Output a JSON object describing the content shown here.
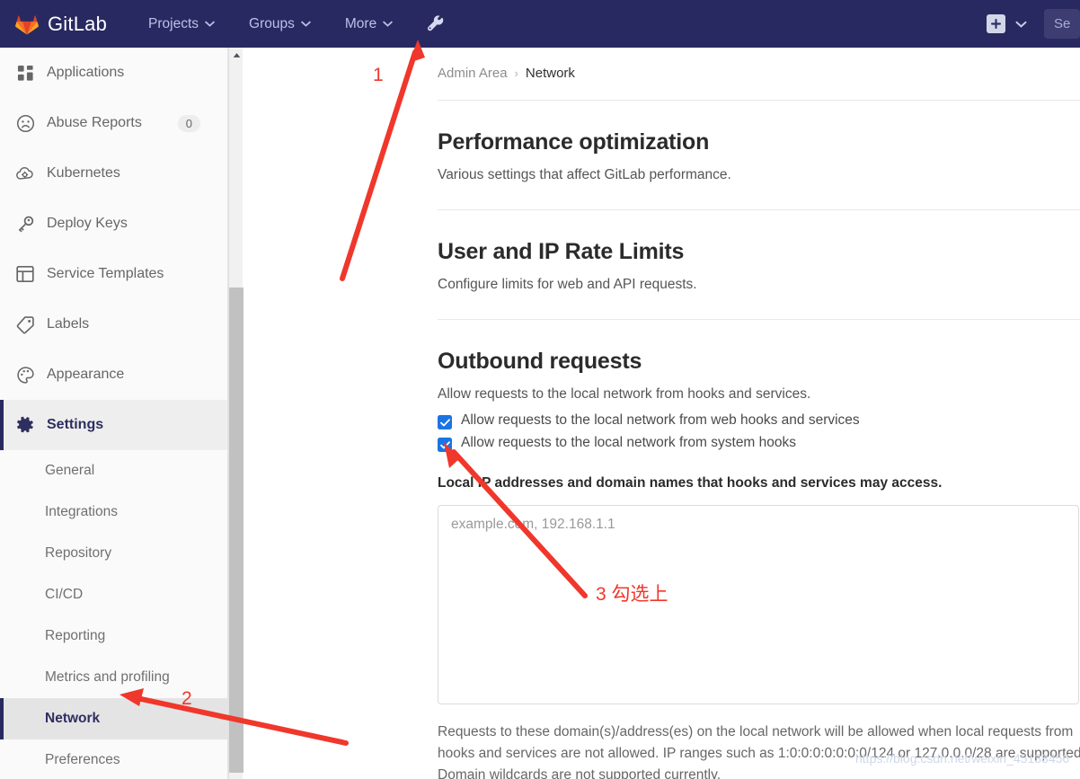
{
  "navbar": {
    "brand": "GitLab",
    "brand_logo_icon": "gitlab-tanuki-logo",
    "items": [
      {
        "label": "Projects",
        "icon": "chevron-down-icon"
      },
      {
        "label": "Groups",
        "icon": "chevron-down-icon"
      },
      {
        "label": "More",
        "icon": "chevron-down-icon"
      }
    ],
    "admin_icon": "wrench-icon",
    "new_icon": "plus-icon",
    "new_chevron_icon": "chevron-down-icon",
    "search_value": "Se",
    "search_placeholder": "Search"
  },
  "sidebar": {
    "items": [
      {
        "label": "Applications",
        "icon": "grid-applications-icon",
        "badge": "",
        "active": false
      },
      {
        "label": "Abuse Reports",
        "icon": "frown-face-icon",
        "badge": "0",
        "active": false
      },
      {
        "label": "Kubernetes",
        "icon": "cloud-gear-icon",
        "badge": "",
        "active": false
      },
      {
        "label": "Deploy Keys",
        "icon": "key-icon",
        "badge": "",
        "active": false
      },
      {
        "label": "Service Templates",
        "icon": "layout-template-icon",
        "badge": "",
        "active": false
      },
      {
        "label": "Labels",
        "icon": "tag-icon",
        "badge": "",
        "active": false
      },
      {
        "label": "Appearance",
        "icon": "palette-icon",
        "badge": "",
        "active": false
      },
      {
        "label": "Settings",
        "icon": "gear-icon",
        "badge": "",
        "active": true
      }
    ],
    "settings_children": [
      {
        "label": "General",
        "current": false
      },
      {
        "label": "Integrations",
        "current": false
      },
      {
        "label": "Repository",
        "current": false
      },
      {
        "label": "CI/CD",
        "current": false
      },
      {
        "label": "Reporting",
        "current": false
      },
      {
        "label": "Metrics and profiling",
        "current": false
      },
      {
        "label": "Network",
        "current": true
      },
      {
        "label": "Preferences",
        "current": false
      }
    ],
    "scrollbar_up_icon": "triangle-up-icon"
  },
  "breadcrumb": {
    "root": "Admin Area",
    "separator": "›",
    "current": "Network"
  },
  "main": {
    "sections": [
      {
        "title": "Performance optimization",
        "desc": "Various settings that affect GitLab performance."
      },
      {
        "title": "User and IP Rate Limits",
        "desc": "Configure limits for web and API requests."
      },
      {
        "title": "Outbound requests",
        "desc": "Allow requests to the local network from hooks and services."
      }
    ],
    "checkboxes": [
      {
        "label": "Allow requests to the local network from web hooks and services",
        "checked": true
      },
      {
        "label": "Allow requests to the local network from system hooks",
        "checked": true
      }
    ],
    "field_label": "Local IP addresses and domain names that hooks and services may access.",
    "textarea_value": "",
    "textarea_placeholder": "example.com, 192.168.1.1",
    "help_text": "Requests to these domain(s)/address(es) on the local network will be allowed when local requests from hooks and services are not allowed. IP ranges such as 1:0:0:0:0:0:0:0/124 or 127.0.0.0/28 are supported. Domain wildcards are not supported currently."
  },
  "annotations": [
    {
      "label": "1",
      "kind": "number"
    },
    {
      "label": "2",
      "kind": "number"
    },
    {
      "label": "3 勾选上",
      "kind": "text"
    }
  ],
  "watermark": "https://blog.csdn.net/weixin_45138456",
  "colors": {
    "navbar_bg": "#292961",
    "accent_blue": "#1b74e4",
    "annotation_red": "#f0372b",
    "sidebar_bg": "#fafafa",
    "active_border": "#292961"
  }
}
